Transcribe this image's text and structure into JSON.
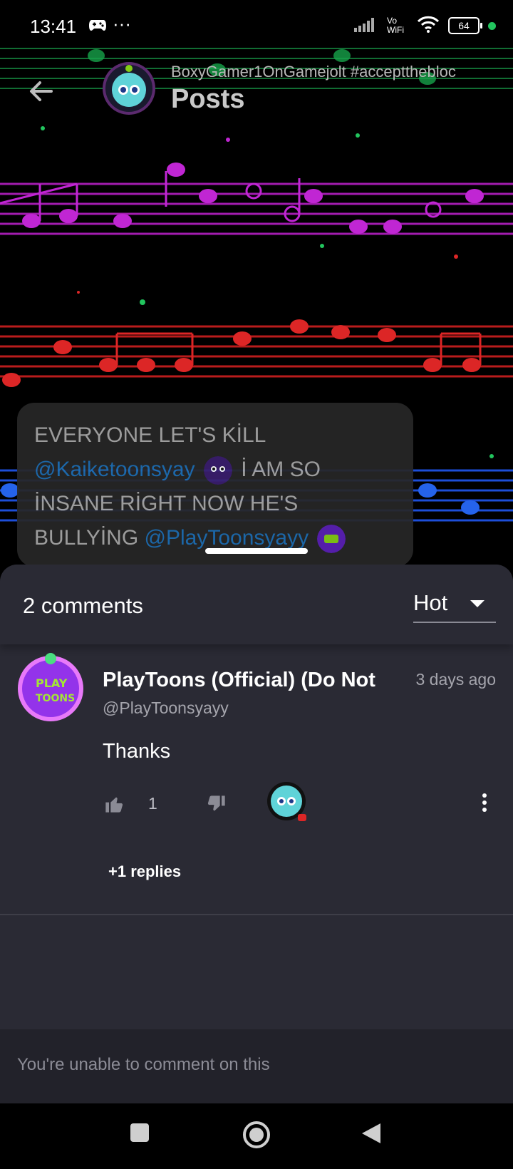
{
  "status_bar": {
    "time": "13:41",
    "extra": "···",
    "network": "Vo WiFi",
    "battery": "64"
  },
  "header": {
    "username": "BoxyGamer1OnGamejolt #acceptthebloc",
    "title": "Posts"
  },
  "post": {
    "line1": "EVERYONE LET'S KİLL",
    "mention1": "@Kaiketoonsyay",
    "line2": "İ AM SO",
    "line3": "İNSANE RİGHT NOW HE'S",
    "line4": "BULLYİNG",
    "mention2": "@PlayToonsyayy"
  },
  "comments_panel": {
    "count_label": "2 comments",
    "sort": {
      "selected": "Hot"
    }
  },
  "comment": {
    "author": "PlayToons (Official) (Do Not",
    "time": "3 days ago",
    "handle": "@PlayToonsyayy",
    "body": "Thanks",
    "likes": "1",
    "replies_label": "+1 replies"
  },
  "comment_bar": {
    "text": "You're unable to comment on this"
  },
  "icons": {
    "back": "arrow-left-icon",
    "like": "thumbs-up-icon",
    "dislike": "thumbs-down-icon",
    "more": "more-vertical-icon",
    "caret": "chevron-down-icon"
  },
  "colors": {
    "mention": "#1f6fb5",
    "sheet_bg": "#2a2a34",
    "green_staff": "#22c55e",
    "purple_staff": "#c026d3",
    "red_staff": "#dc2626",
    "blue_staff": "#2563eb"
  }
}
